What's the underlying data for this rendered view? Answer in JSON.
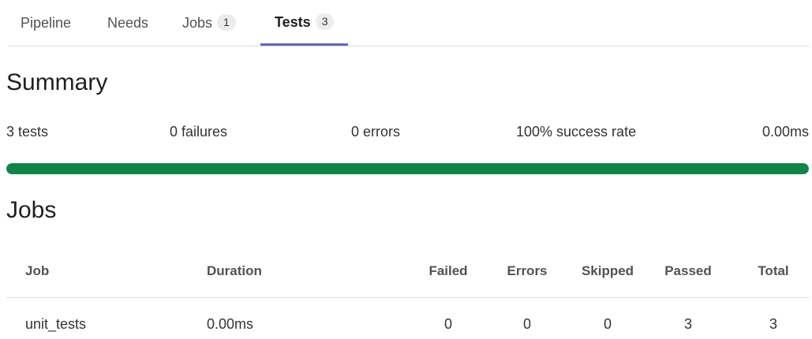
{
  "tabs": [
    {
      "label": "Pipeline",
      "count": null,
      "active": false
    },
    {
      "label": "Needs",
      "count": null,
      "active": false
    },
    {
      "label": "Jobs",
      "count": "1",
      "active": false
    },
    {
      "label": "Tests",
      "count": "3",
      "active": true
    }
  ],
  "summary": {
    "title": "Summary",
    "tests": "3 tests",
    "failures": "0 failures",
    "errors": "0 errors",
    "success_rate": "100% success rate",
    "duration": "0.00ms",
    "progress_fraction": 1.0,
    "progress_color": "#108548"
  },
  "jobs": {
    "title": "Jobs",
    "headers": {
      "job": "Job",
      "duration": "Duration",
      "failed": "Failed",
      "errors": "Errors",
      "skipped": "Skipped",
      "passed": "Passed",
      "total": "Total"
    },
    "rows": [
      {
        "job": "unit_tests",
        "duration": "0.00ms",
        "failed": "0",
        "errors": "0",
        "skipped": "0",
        "passed": "3",
        "total": "3"
      }
    ]
  },
  "colors": {
    "accent_tab_underline": "#6666c4",
    "success": "#108548"
  }
}
